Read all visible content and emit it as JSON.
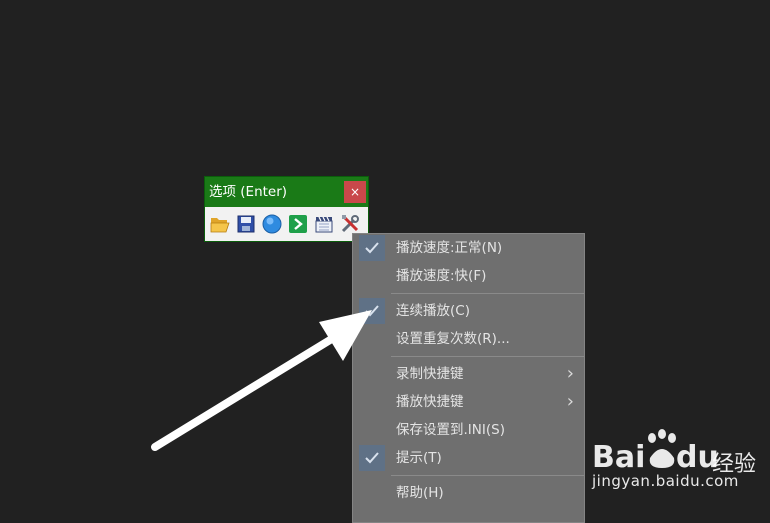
{
  "options_window": {
    "title": "选项 (Enter)",
    "close_glyph": "×",
    "toolbar_icons": [
      "folder-open-icon",
      "save-icon",
      "globe-icon",
      "arrow-right-icon",
      "clapperboard-icon",
      "tools-icon"
    ]
  },
  "context_menu": {
    "groups": [
      [
        {
          "label": "播放速度:正常(N)",
          "checked": true,
          "submenu": false
        },
        {
          "label": "播放速度:快(F)",
          "checked": false,
          "submenu": false
        }
      ],
      [
        {
          "label": "连续播放(C)",
          "checked": true,
          "submenu": false
        },
        {
          "label": "设置重复次数(R)...",
          "checked": false,
          "submenu": false
        }
      ],
      [
        {
          "label": "录制快捷键",
          "checked": false,
          "submenu": true
        },
        {
          "label": "播放快捷键",
          "checked": false,
          "submenu": true
        },
        {
          "label": "保存设置到.INI(S)",
          "checked": false,
          "submenu": false
        },
        {
          "label": "提示(T)",
          "checked": true,
          "submenu": false
        }
      ],
      [
        {
          "label": "帮助(H)",
          "checked": false,
          "submenu": false
        }
      ]
    ]
  },
  "watermark": {
    "brand_bai": "Bai",
    "brand_du": "du",
    "brand_jingyan": "经验",
    "url": "jingyan.baidu.com"
  },
  "colors": {
    "background": "#212121",
    "title_bar": "#1a7a17",
    "close_button": "#c9484a",
    "menu_bg": "#6f6f6f",
    "check_bg": "#5f7186",
    "arrow": "#ffffff"
  }
}
